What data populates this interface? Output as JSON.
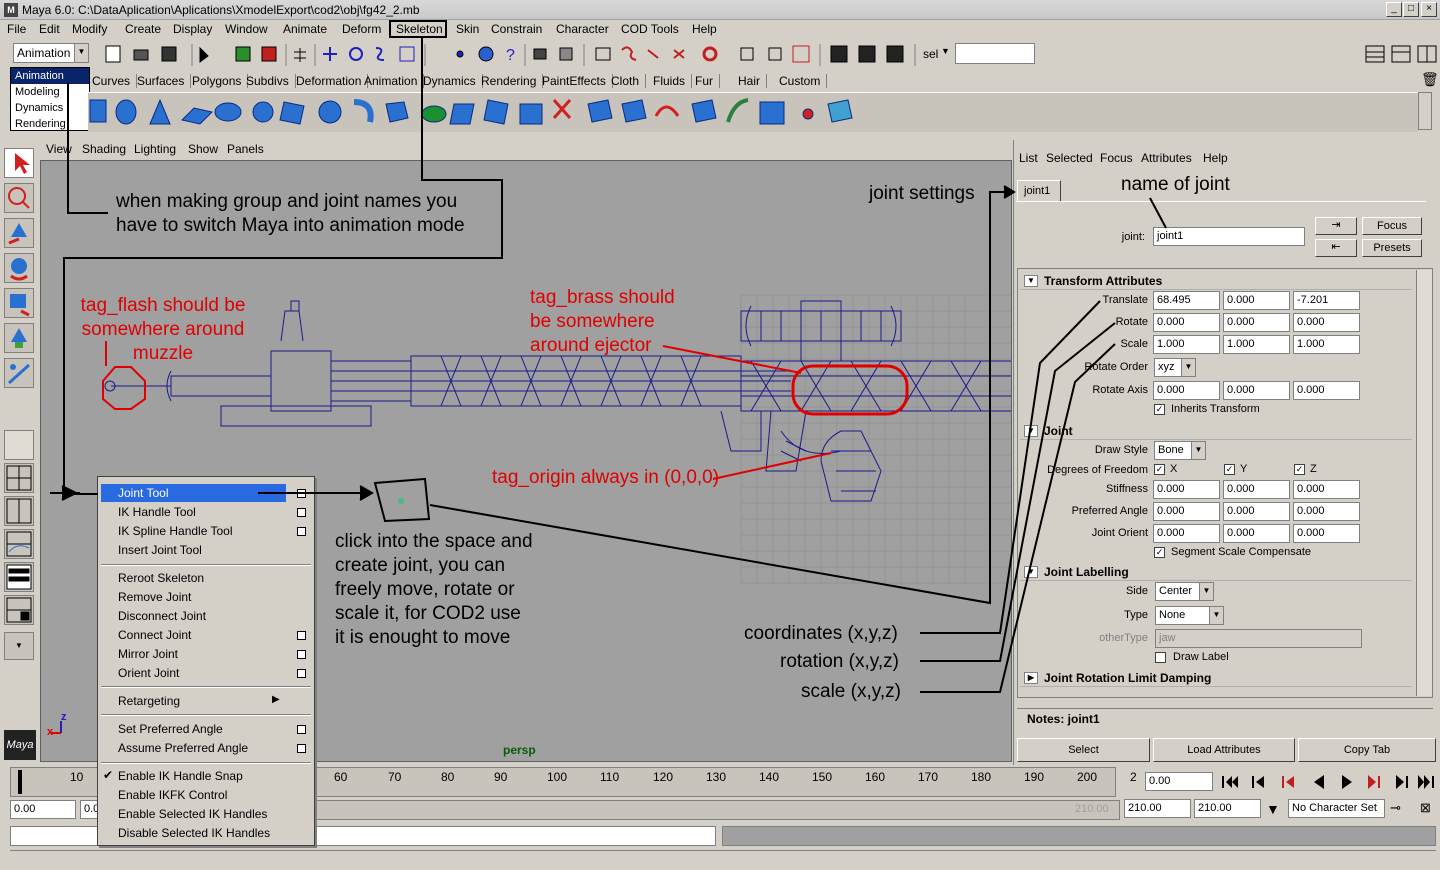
{
  "window": {
    "title": "Maya 6.0: C:\\DataAplication\\Aplications\\XmodelExport\\cod2\\obj\\fg42_2.mb",
    "logo": "M",
    "min_btn": "_",
    "max_btn": "□",
    "close_btn": "×"
  },
  "menubar": [
    "File",
    "Edit",
    "Modify",
    "Create",
    "Display",
    "Window",
    "Animate",
    "Deform",
    "Skeleton",
    "Skin",
    "Constrain",
    "Character",
    "COD Tools",
    "Help"
  ],
  "toolbar": {
    "mode_value": "Animation",
    "sel_label": "sel",
    "sel_value": ""
  },
  "mode_options": [
    "Animation",
    "Modeling",
    "Dynamics",
    "Rendering"
  ],
  "shelf_tabs": [
    "Curves",
    "Surfaces",
    "Polygons",
    "Subdivs",
    "Deformation",
    "Animation",
    "Dynamics",
    "Rendering",
    "PaintEffects",
    "Cloth",
    "Fluids",
    "Fur",
    "Hair",
    "Custom"
  ],
  "viewport": {
    "menu": [
      "View",
      "Shading",
      "Lighting",
      "Show",
      "Panels"
    ],
    "camera_label": "persp",
    "axis_x": "x",
    "axis_z": "z"
  },
  "popup_menu": [
    {
      "label": "Joint Tool",
      "option": true,
      "selected": true
    },
    {
      "label": "IK Handle Tool",
      "option": true
    },
    {
      "label": "IK Spline Handle Tool",
      "option": true
    },
    {
      "label": "Insert Joint Tool",
      "option": false
    },
    {
      "label": "Reroot Skeleton",
      "option": false
    },
    {
      "label": "Remove Joint",
      "option": false
    },
    {
      "label": "Disconnect Joint",
      "option": false
    },
    {
      "label": "Connect Joint",
      "option": true
    },
    {
      "label": "Mirror Joint",
      "option": true
    },
    {
      "label": "Orient Joint",
      "option": true
    },
    {
      "label": "Retargeting",
      "submenu": true
    },
    {
      "label": "Set Preferred Angle",
      "option": true
    },
    {
      "label": "Assume Preferred Angle",
      "option": true
    },
    {
      "label": "Enable IK Handle Snap",
      "checked": true
    },
    {
      "label": "Enable IKFK Control"
    },
    {
      "label": "Enable Selected IK Handles"
    },
    {
      "label": "Disable Selected IK Handles"
    }
  ],
  "attr_editor": {
    "menu": [
      "List",
      "Selected",
      "Focus",
      "Attributes",
      "Help"
    ],
    "tab": "joint1",
    "node_label": "joint:",
    "node_value": "joint1",
    "focus_btn": "Focus",
    "presets_btn": "Presets",
    "transform_header": "Transform Attributes",
    "translate_label": "Translate",
    "translate": [
      "68.495",
      "0.000",
      "-7.201"
    ],
    "rotate_label": "Rotate",
    "rotate": [
      "0.000",
      "0.000",
      "0.000"
    ],
    "scale_label": "Scale",
    "scale": [
      "1.000",
      "1.000",
      "1.000"
    ],
    "rotate_order_label": "Rotate Order",
    "rotate_order": "xyz",
    "rotate_axis_label": "Rotate Axis",
    "rotate_axis": [
      "0.000",
      "0.000",
      "0.000"
    ],
    "inherits_label": "Inherits Transform",
    "joint_header": "Joint",
    "draw_style_label": "Draw Style",
    "draw_style": "Bone",
    "dof_label": "Degrees of Freedom",
    "dof": [
      "X",
      "Y",
      "Z"
    ],
    "stiffness_label": "Stiffness",
    "stiffness": [
      "0.000",
      "0.000",
      "0.000"
    ],
    "preferred_label": "Preferred Angle",
    "preferred": [
      "0.000",
      "0.000",
      "0.000"
    ],
    "orient_label": "Joint Orient",
    "orient": [
      "0.000",
      "0.000",
      "0.000"
    ],
    "segment_label": "Segment Scale Compensate",
    "labelling_header": "Joint Labelling",
    "side_label": "Side",
    "side": "Center",
    "type_label": "Type",
    "type": "None",
    "other_type_label": "otherType",
    "other_type": "jaw",
    "draw_label": "Draw Label",
    "damping_header": "Joint Rotation Limit Damping",
    "notes": "Notes: joint1",
    "select_btn": "Select",
    "load_btn": "Load Attributes",
    "copy_btn": "Copy Tab"
  },
  "timeline": {
    "ticks": [
      "10",
      "60",
      "70",
      "80",
      "90",
      "100",
      "110",
      "120",
      "130",
      "140",
      "150",
      "160",
      "170",
      "180",
      "190",
      "200",
      "2"
    ],
    "current_time": "0.00",
    "start_time": "0.00",
    "start_time2": "0.0",
    "end_time": "210.00",
    "end_time2": "210.00",
    "range_end": "210.00",
    "character_set": "No Character Set"
  },
  "annotations": {
    "mode_note": "when making group and joint names you have to switch Maya into animation mode",
    "flash_note": "tag_flash should be somewhere around muzzle",
    "brass_note": "tag_brass should be somewhere around ejector",
    "origin_note": "tag_origin always in (0,0,0)",
    "joint_settings": "joint settings",
    "name_of_joint": "name of joint",
    "click_note": "click into the space and create joint, you can freely move, rotate or scale it, for COD2 use it is enought to move",
    "coords": "coordinates (x,y,z)",
    "rotation": "rotation (x,y,z)",
    "scale": "scale (x,y,z)"
  },
  "colors": {
    "wire": "#1a1a8c",
    "annotation_red": "#e00000",
    "selection": "#0a246a"
  }
}
